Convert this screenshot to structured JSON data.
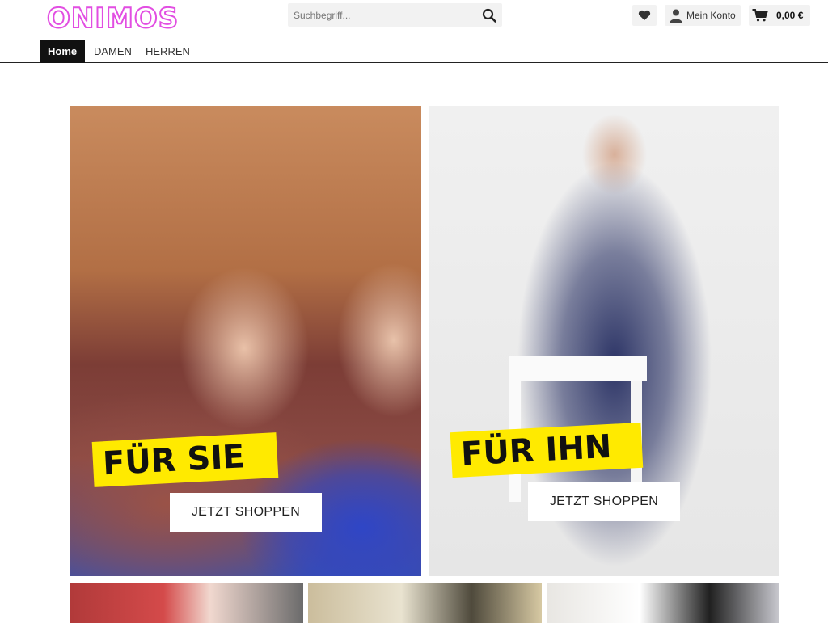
{
  "brand": {
    "logo_text": "ONIMOS",
    "logo_color": "#e24ee2"
  },
  "search": {
    "placeholder": "Suchbegriff...",
    "value": ""
  },
  "header": {
    "account_label": "Mein Konto",
    "cart_total": "0,00 €"
  },
  "icons": {
    "search": "search-icon",
    "wishlist": "heart-icon",
    "account": "user-icon",
    "cart": "cart-icon"
  },
  "nav": {
    "items": [
      {
        "label": "Home",
        "active": true
      },
      {
        "label": "DAMEN"
      },
      {
        "label": "HERREN"
      }
    ]
  },
  "promos": [
    {
      "tag": "FÜR SIE",
      "button": "JETZT SHOPPEN"
    },
    {
      "tag": "FÜR IHN",
      "button": "JETZT SHOPPEN"
    }
  ],
  "colors": {
    "tag_bg": "#ffea00",
    "nav_active_bg": "#111111"
  }
}
